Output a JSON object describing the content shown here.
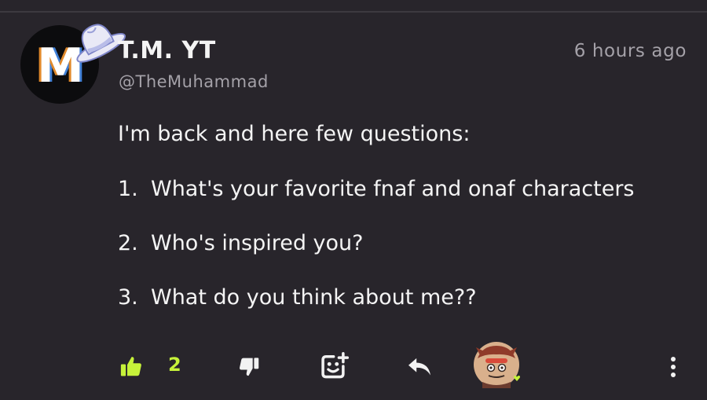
{
  "post": {
    "author": {
      "display_name": "T.M. YT",
      "handle": "@TheMuhammad",
      "avatar_letter": "M"
    },
    "timestamp": "6 hours ago",
    "intro": "I'm back and here few questions:",
    "questions": [
      {
        "num": "1.",
        "text": "What's your favorite fnaf and onaf characters"
      },
      {
        "num": "2.",
        "text": "Who's inspired you?"
      },
      {
        "num": "3.",
        "text": "What do you think about me??"
      }
    ]
  },
  "actions": {
    "like_count": "2",
    "like_icon": "thumbs-up-icon",
    "dislike_icon": "thumbs-down-icon",
    "emoji_icon": "add-reaction-icon",
    "reply_icon": "reply-icon",
    "more_icon": "more-vertical-icon"
  },
  "colors": {
    "background": "#28252b",
    "accent": "#c6f23a",
    "muted_text": "#a4a1a8",
    "primary_text": "#f4f4f4"
  }
}
